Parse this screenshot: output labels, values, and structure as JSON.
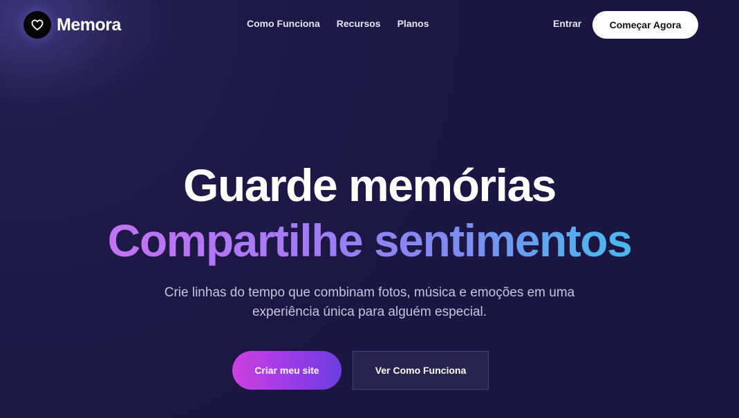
{
  "header": {
    "brand": "Memora",
    "nav": [
      {
        "label": "Como Funciona"
      },
      {
        "label": "Recursos"
      },
      {
        "label": "Planos"
      }
    ],
    "login_label": "Entrar",
    "start_label": "Começar Agora"
  },
  "hero": {
    "title_line1": "Guarde memórias",
    "title_line2": "Compartilhe sentimentos",
    "subtitle_line1": "Crie linhas do tempo que combinam fotos, música e emoções em uma",
    "subtitle_line2": "experiência única para alguém especial.",
    "primary_cta": "Criar meu site",
    "secondary_cta": "Ver Como Funciona"
  },
  "icons": {
    "logo": "heart-icon"
  },
  "colors": {
    "background": "#1f1948",
    "gradient_start": "#d36ff0",
    "gradient_end": "#2ec7ea",
    "cta_start": "#cc40e0",
    "cta_end": "#6a3ddf"
  }
}
